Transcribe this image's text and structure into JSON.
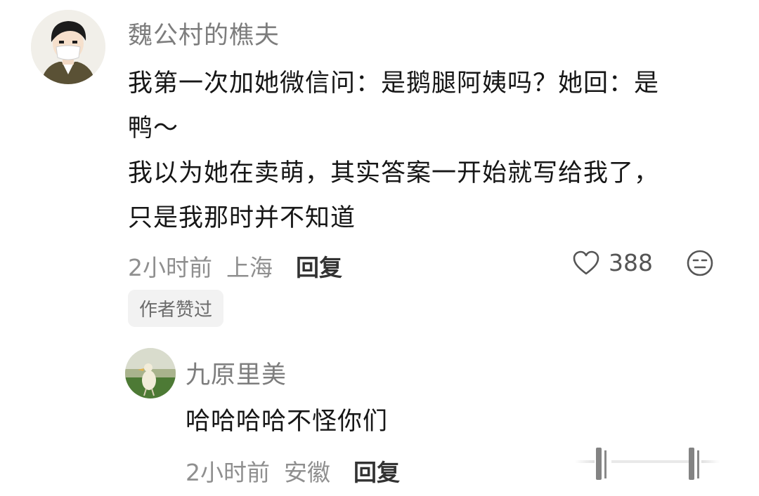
{
  "comment": {
    "username": "魏公村的樵夫",
    "text_lines": [
      "我第一次加她微信问：是鹅腿阿姨吗？她回：是",
      "鸭～",
      "我以为她在卖萌，其实答案一开始就写给我了，",
      "只是我那时并不知道"
    ],
    "time": "2小时前",
    "location": "上海",
    "reply_label": "回复",
    "like_count": "388",
    "author_badge": "作者赞过"
  },
  "reply": {
    "username": "九原里美",
    "text": "哈哈哈哈不怪你们",
    "time": "2小时前",
    "location": "安徽",
    "reply_label": "回复"
  },
  "icons": {
    "like": "heart-outline-icon",
    "dislike": "meh-face-icon",
    "watermark": "app-logo-watermark-icon"
  }
}
